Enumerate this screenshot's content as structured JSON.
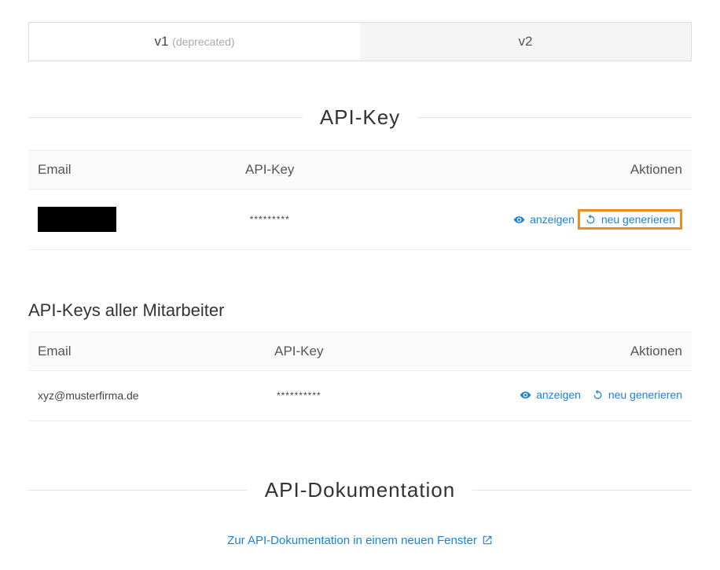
{
  "tabs": {
    "v1": "v1",
    "v1_suffix": "(deprecated)",
    "v2": "v2"
  },
  "section_api_key": {
    "title": "API-Key",
    "columns": {
      "email": "Email",
      "key": "API-Key",
      "actions": "Aktionen"
    },
    "rows": [
      {
        "email": "",
        "key": "*********"
      }
    ]
  },
  "section_staff": {
    "title": "API-Keys aller Mitarbeiter",
    "columns": {
      "email": "Email",
      "key": "API-Key",
      "actions": "Aktionen"
    },
    "rows": [
      {
        "email": "xyz@musterfirma.de",
        "key": "**********"
      }
    ]
  },
  "actions": {
    "show": "anzeigen",
    "regen": "neu generieren"
  },
  "section_docs": {
    "title": "API-Dokumentation",
    "link_label": "Zur API-Dokumentation in einem neuen Fenster"
  }
}
